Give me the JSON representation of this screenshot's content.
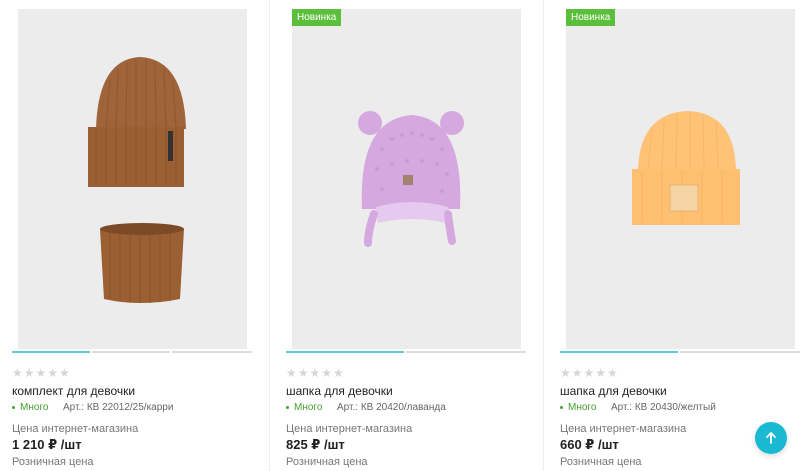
{
  "products": [
    {
      "badge": "",
      "name": "комплект для девочки",
      "availability": "Много",
      "article": "Арт.: КВ 22012/25/карри",
      "price_label": "Цена интернет-магазина",
      "price": "1 210 ₽ /шт",
      "retail_label": "Розничная цена",
      "rating": 0,
      "image_icon": "hat-and-snood-icon",
      "color": "#9a5f32"
    },
    {
      "badge": "Новинка",
      "name": "шапка для девочки",
      "availability": "Много",
      "article": "Арт.: КВ 20420/лаванда",
      "price_label": "Цена интернет-магазина",
      "price": "825 ₽ /шт",
      "retail_label": "Розничная цена",
      "rating": 0,
      "image_icon": "bear-ear-hat-icon",
      "color": "#d5a8df"
    },
    {
      "badge": "Новинка",
      "name": "шапка для девочки",
      "availability": "Много",
      "article": "Арт.: КВ 20430/желтый",
      "price_label": "Цена интернет-магазина",
      "price": "660 ₽ /шт",
      "retail_label": "Розничная цена",
      "rating": 0,
      "image_icon": "beanie-hat-icon",
      "color": "#ffc277"
    }
  ],
  "scroll_top": {
    "icon": "arrow-up-icon"
  },
  "colors": {
    "badge": "#5bbf3c",
    "availability": "#45a02e",
    "slider_active": "#5fc9d8",
    "scroll_button": "#19b9d1"
  }
}
